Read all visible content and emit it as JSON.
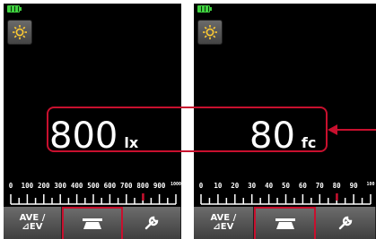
{
  "left_screen": {
    "reading_value": "800",
    "reading_unit": "lx",
    "scale_labels": [
      "0",
      "100",
      "200",
      "300",
      "400",
      "500",
      "600",
      "700",
      "800",
      "900",
      "1000"
    ]
  },
  "right_screen": {
    "reading_value": "80",
    "reading_unit": "fc",
    "scale_labels": [
      "0",
      "10",
      "20",
      "30",
      "40",
      "50",
      "60",
      "70",
      "80",
      "90",
      "100"
    ]
  },
  "bottom_tabs": {
    "ave_label": "AVE /\n⊿EV"
  },
  "colors": {
    "background": "#000000",
    "highlight": "#c8102e",
    "battery": "#3fd13f",
    "settings_icon": "#ffcc33",
    "needle": "#c8102e"
  },
  "icons": {
    "settings": "gear-sun-icon",
    "battery": "battery-icon",
    "receptor": "flat-receptor-icon",
    "tools": "wrench-icon",
    "callout": "arrow-left-icon"
  },
  "indicator": {
    "scale_fraction": 0.8
  }
}
